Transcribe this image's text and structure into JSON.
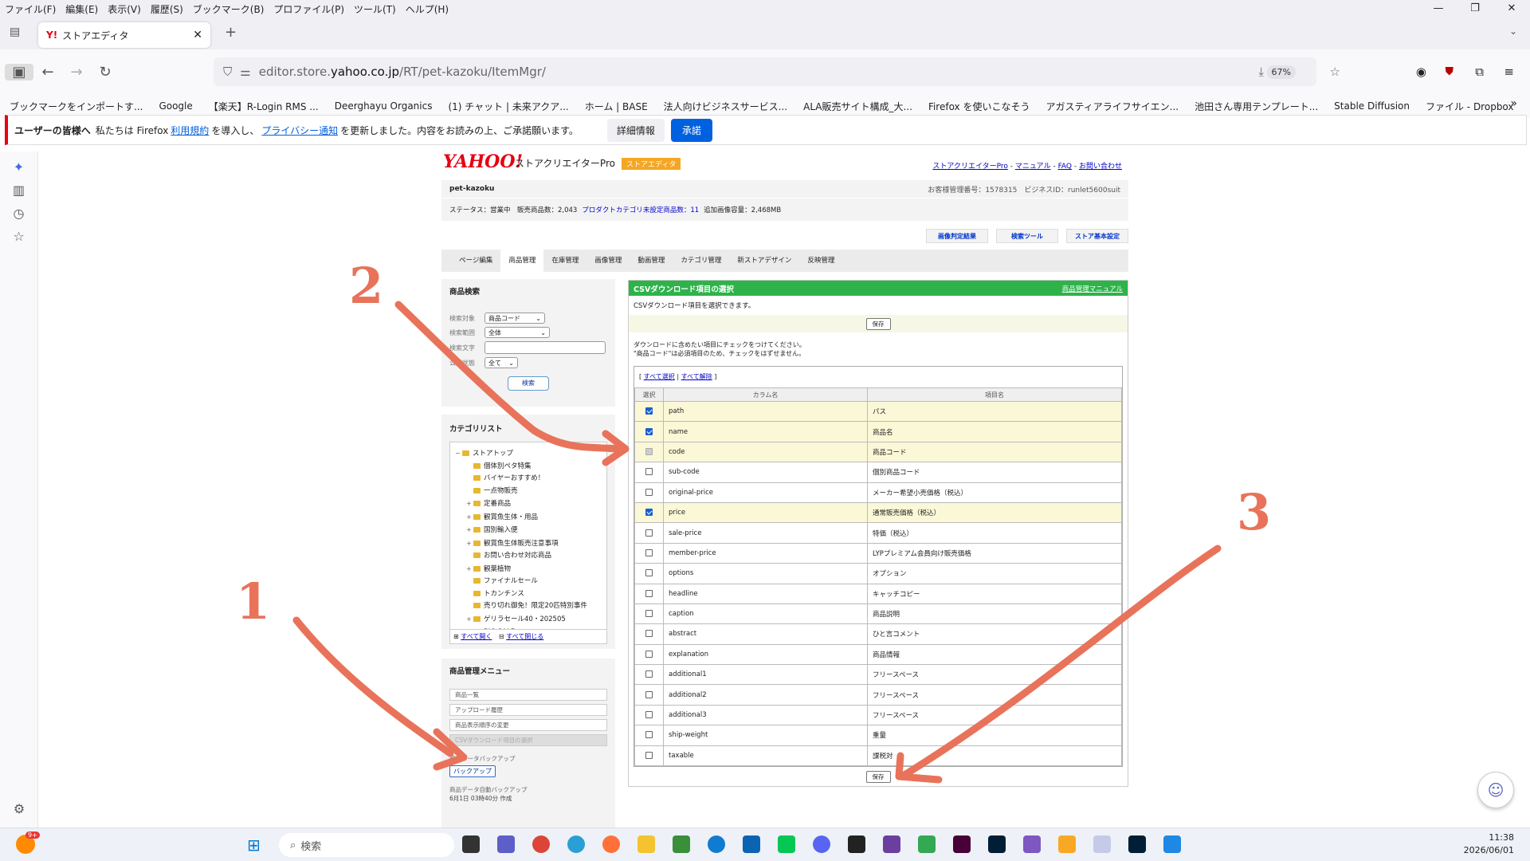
{
  "browser": {
    "menu": [
      "ファイル(F)",
      "編集(E)",
      "表示(V)",
      "履歴(S)",
      "ブックマーク(B)",
      "プロファイル(P)",
      "ツール(T)",
      "ヘルプ(H)"
    ],
    "tab_title": "ストアエディタ",
    "url_prefix": "editor.store.",
    "url_host": "yahoo.co.jp",
    "url_path": "/RT/pet-kazoku/ItemMgr/",
    "zoom": "67%",
    "bookmarks": [
      "ブックマークをインポートす...",
      "Google",
      "【楽天】R-Login RMS ...",
      "Deerghayu Organics",
      "(1) チャット | 未来アクア...",
      "ホーム | BASE",
      "法人向けビジネスサービス...",
      "ALA販売サイト構成_大...",
      "Firefox を使いこなそう",
      "アガスティアライフサイエン...",
      "池田さん専用テンプレート...",
      "Stable Diffusion",
      "ファイル - Dropbox"
    ],
    "notice": {
      "prefix": "ユーザーの皆様へ",
      "text1": "私たちは Firefox",
      "link1": "利用規約",
      "text2": "を導入し、",
      "link2": "プライバシー通知",
      "text3": "を更新しました。内容をお読みの上、ご承諾願います。",
      "details": "詳細情報",
      "accept": "承諾"
    }
  },
  "site": {
    "logo": "YAHOO!",
    "logo_sub": "ストアクリエイターPro",
    "badge": "ストアエディタ",
    "toplinks": [
      "ストアクリエイターPro",
      "マニュアル",
      "FAQ",
      "お問い合わせ"
    ],
    "shop": "pet-kazoku",
    "account": "お客様管理番号：1578315　ビジネスID：runlet5600suit",
    "status": "ステータス：営業中　販売商品数：2,043",
    "status_link": "プロダクトカテゴリ未設定商品数：11",
    "status_capacity": "追加画像容量：2,468MB",
    "tools": [
      "画像判定結果",
      "検索ツール",
      "ストア基本設定"
    ],
    "tabs": [
      "ページ編集",
      "商品管理",
      "在庫管理",
      "画像管理",
      "動画管理",
      "カテゴリ管理",
      "新ストアデザイン",
      "反映管理"
    ]
  },
  "search": {
    "title": "商品検索",
    "target_label": "検索対象",
    "target_value": "商品コード",
    "range_label": "検索範囲",
    "range_value": "全体",
    "keyword_label": "検索文字",
    "public_label": "公開状態",
    "public_value": "全て",
    "button": "検索"
  },
  "category": {
    "title": "カテゴリリスト",
    "items": [
      {
        "label": "ストアトップ",
        "indent": 0,
        "exp": "−"
      },
      {
        "label": "個体別ペタ特集",
        "indent": 1,
        "exp": ""
      },
      {
        "label": "バイヤーおすすめ！",
        "indent": 1,
        "exp": ""
      },
      {
        "label": "一点物販売",
        "indent": 1,
        "exp": ""
      },
      {
        "label": "定番商品",
        "indent": 1,
        "exp": "+"
      },
      {
        "label": "観賞魚生体・用品",
        "indent": 1,
        "exp": "+"
      },
      {
        "label": "国別輸入便",
        "indent": 1,
        "exp": "+"
      },
      {
        "label": "観賞魚生体販売注意事項",
        "indent": 1,
        "exp": "+"
      },
      {
        "label": "お問い合わせ対応商品",
        "indent": 1,
        "exp": ""
      },
      {
        "label": "観葉植物",
        "indent": 1,
        "exp": "+"
      },
      {
        "label": "ファイナルセール",
        "indent": 1,
        "exp": ""
      },
      {
        "label": "トカンチンス",
        "indent": 1,
        "exp": ""
      },
      {
        "label": "売り切れ御免！限定20匹特別事件",
        "indent": 1,
        "exp": ""
      },
      {
        "label": "ゲリラセール40・202505",
        "indent": 1,
        "exp": "+"
      },
      {
        "label": "BIG SALE",
        "indent": 1,
        "exp": "+"
      }
    ],
    "expand_all": "すべて開く",
    "collapse_all": "すべて閉じる"
  },
  "menu": {
    "title": "商品管理メニュー",
    "items": [
      "商品一覧",
      "アップロード履歴",
      "商品表示順序の変更",
      "CSVダウンロード項目の選択"
    ],
    "backup_label": "商品データバックアップ",
    "backup_button": "バックアップ",
    "auto_backup_label": "商品データ自動バックアップ",
    "auto_backup_date": "6月1日 03時40分 作成"
  },
  "csv": {
    "title": "CSVダウンロード項目の選択",
    "manual": "商品管理マニュアル",
    "desc": "CSVダウンロード項目を選択できます。",
    "save": "保存",
    "instr1": "ダウンロードに含めたい項目にチェックをつけてください。",
    "instr2": "\"商品コード\"は必須項目のため、チェックをはずせません。",
    "select_all": "すべて選択",
    "deselect_all": "すべて解除",
    "col_select": "選択",
    "col_column": "カラム名",
    "col_item": "項目名",
    "rows": [
      {
        "col": "path",
        "item": "パス",
        "state": "on"
      },
      {
        "col": "name",
        "item": "商品名",
        "state": "on"
      },
      {
        "col": "code",
        "item": "商品コード",
        "state": "dis"
      },
      {
        "col": "sub-code",
        "item": "個別商品コード",
        "state": "off"
      },
      {
        "col": "original-price",
        "item": "メーカー希望小売価格（税込）",
        "state": "off"
      },
      {
        "col": "price",
        "item": "通常販売価格（税込）",
        "state": "on"
      },
      {
        "col": "sale-price",
        "item": "特価（税込）",
        "state": "off"
      },
      {
        "col": "member-price",
        "item": "LYPプレミアム会員向け販売価格",
        "state": "off"
      },
      {
        "col": "options",
        "item": "オプション",
        "state": "off"
      },
      {
        "col": "headline",
        "item": "キャッチコピー",
        "state": "off"
      },
      {
        "col": "caption",
        "item": "商品説明",
        "state": "off"
      },
      {
        "col": "abstract",
        "item": "ひと言コメント",
        "state": "off"
      },
      {
        "col": "explanation",
        "item": "商品情報",
        "state": "off"
      },
      {
        "col": "additional1",
        "item": "フリースペース",
        "state": "off"
      },
      {
        "col": "additional2",
        "item": "フリースペース",
        "state": "off"
      },
      {
        "col": "additional3",
        "item": "フリースペース",
        "state": "off"
      },
      {
        "col": "ship-weight",
        "item": "重量",
        "state": "off"
      },
      {
        "col": "taxable",
        "item": "課税対",
        "state": "off"
      }
    ]
  },
  "annotations": [
    "1",
    "2",
    "3"
  ],
  "taskbar": {
    "search": "検索",
    "time": "11:38",
    "date": "2026/06/01",
    "badge": "9+"
  }
}
